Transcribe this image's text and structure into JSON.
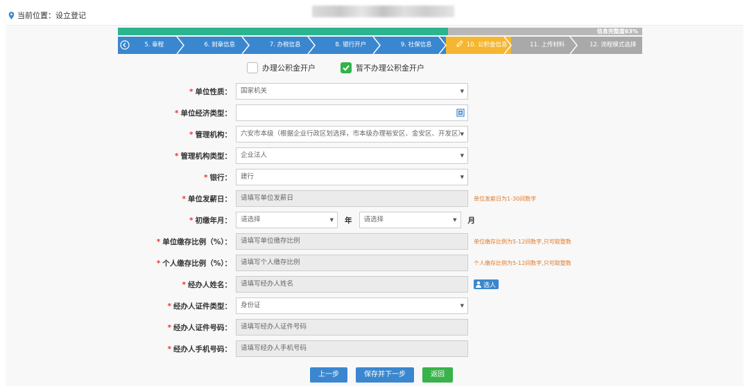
{
  "location": {
    "text": "当前位置：设立登记"
  },
  "progress": {
    "percent": 63,
    "label": "信息完整度63%"
  },
  "steps": [
    {
      "label": "5. 章程",
      "state": "done"
    },
    {
      "label": "6. 刻章信息",
      "state": "done"
    },
    {
      "label": "7. 办税信息",
      "state": "done"
    },
    {
      "label": "8. 银行开户",
      "state": "done"
    },
    {
      "label": "9. 社保信息",
      "state": "done"
    },
    {
      "label": "10. 公积金信息",
      "state": "active"
    },
    {
      "label": "11. 上传材料",
      "state": "todo"
    },
    {
      "label": "12. 流程模式选择",
      "state": "todo"
    }
  ],
  "options": {
    "apply": {
      "label": "办理公积金开户",
      "checked": false
    },
    "skip": {
      "label": "暂不办理公积金开户",
      "checked": true
    }
  },
  "form": {
    "unit_nature": {
      "label": "单位性质：",
      "value": "国家机关"
    },
    "unit_econ_type": {
      "label": "单位经济类型：",
      "value": ""
    },
    "mgmt_org": {
      "label": "管理机构：",
      "value": "六安市本级（根据企业行政区划选择，市本级办理裕安区、金安区、开发区）"
    },
    "mgmt_org_type": {
      "label": "管理机构类型：",
      "value": "企业法人"
    },
    "bank": {
      "label": "银行：",
      "value": "建行"
    },
    "pay_day": {
      "label": "单位发薪日：",
      "placeholder": "请填写单位发薪日",
      "hint": "单位发薪日为1-30间数字"
    },
    "first_month": {
      "label": "初缴年月：",
      "year_placeholder": "请选择",
      "year_unit": "年",
      "month_placeholder": "请选择",
      "month_unit": "月"
    },
    "unit_ratio": {
      "label": "单位缴存比例（%）：",
      "placeholder": "请填写单位缴存比例",
      "hint": "单位缴存比例为5-12间数字,只可取整数"
    },
    "personal_ratio": {
      "label": "个人缴存比例（%）：",
      "placeholder": "请填写个人缴存比例",
      "hint": "个人缴存比例为5-12间数字,只可取整数"
    },
    "agent_name": {
      "label": "经办人姓名：",
      "placeholder": "请填写经办人姓名",
      "choose_label": "选人"
    },
    "agent_id_type": {
      "label": "经办人证件类型：",
      "value": "身份证"
    },
    "agent_id_no": {
      "label": "经办人证件号码：",
      "placeholder": "请填写经办人证件号码"
    },
    "agent_phone": {
      "label": "经办人手机号码：",
      "placeholder": "请填写经办人手机号码"
    }
  },
  "buttons": {
    "prev": "上一步",
    "save_next": "保存并下一步",
    "back": "返回"
  },
  "colors": {
    "done": "#3a87cf",
    "active": "#f5b731",
    "todo": "#a9a9a9",
    "progress": "#2cb48e",
    "hint": "#e07a2a"
  }
}
